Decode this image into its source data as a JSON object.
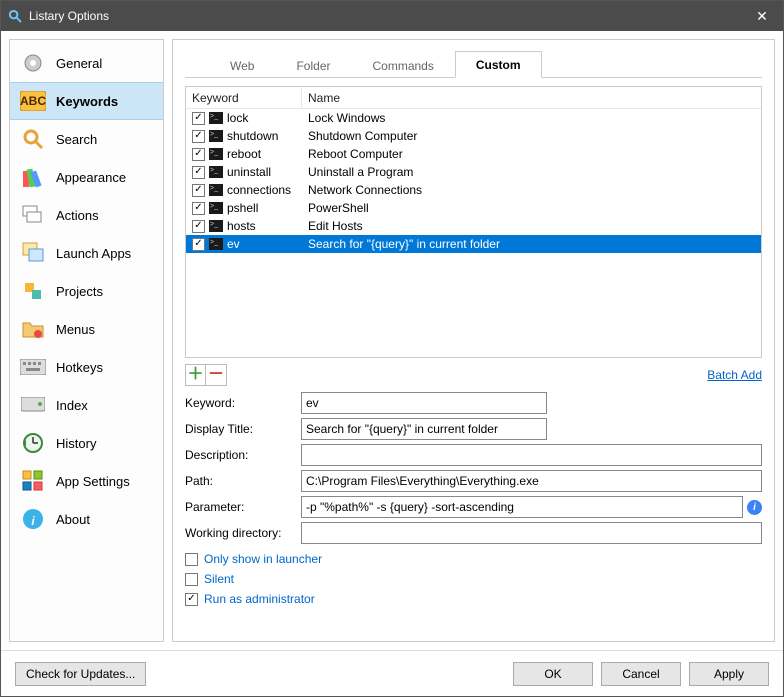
{
  "window": {
    "title": "Listary Options"
  },
  "sidebar": {
    "items": [
      {
        "label": "General"
      },
      {
        "label": "Keywords"
      },
      {
        "label": "Search"
      },
      {
        "label": "Appearance"
      },
      {
        "label": "Actions"
      },
      {
        "label": "Launch Apps"
      },
      {
        "label": "Projects"
      },
      {
        "label": "Menus"
      },
      {
        "label": "Hotkeys"
      },
      {
        "label": "Index"
      },
      {
        "label": "History"
      },
      {
        "label": "App Settings"
      },
      {
        "label": "About"
      }
    ],
    "selected": "Keywords"
  },
  "tabs": {
    "items": [
      "Web",
      "Folder",
      "Commands",
      "Custom"
    ],
    "active": "Custom"
  },
  "list": {
    "headers": {
      "keyword": "Keyword",
      "name": "Name"
    },
    "rows": [
      {
        "checked": true,
        "keyword": "lock",
        "name": "Lock Windows"
      },
      {
        "checked": true,
        "keyword": "shutdown",
        "name": "Shutdown Computer"
      },
      {
        "checked": true,
        "keyword": "reboot",
        "name": "Reboot Computer"
      },
      {
        "checked": true,
        "keyword": "uninstall",
        "name": "Uninstall a Program"
      },
      {
        "checked": true,
        "keyword": "connections",
        "name": "Network Connections"
      },
      {
        "checked": true,
        "keyword": "pshell",
        "name": "PowerShell"
      },
      {
        "checked": true,
        "keyword": "hosts",
        "name": "Edit Hosts"
      },
      {
        "checked": true,
        "keyword": "ev",
        "name": "Search for \"{query}\" in current folder",
        "selected": true
      }
    ]
  },
  "links": {
    "batch_add": "Batch Add"
  },
  "form": {
    "labels": {
      "keyword": "Keyword:",
      "display_title": "Display Title:",
      "description": "Description:",
      "path": "Path:",
      "parameter": "Parameter:",
      "working_dir": "Working directory:"
    },
    "values": {
      "keyword": "ev",
      "display_title": "Search for \"{query}\" in current folder",
      "description": "",
      "path": "C:\\Program Files\\Everything\\Everything.exe",
      "parameter": "-p \"%path%\" -s {query} -sort-ascending",
      "working_dir": ""
    }
  },
  "options": {
    "only_launcher": {
      "label": "Only show in launcher",
      "checked": false
    },
    "silent": {
      "label": "Silent",
      "checked": false
    },
    "run_admin": {
      "label": "Run as administrator",
      "checked": true
    }
  },
  "footer": {
    "check_updates": "Check for Updates...",
    "ok": "OK",
    "cancel": "Cancel",
    "apply": "Apply"
  }
}
